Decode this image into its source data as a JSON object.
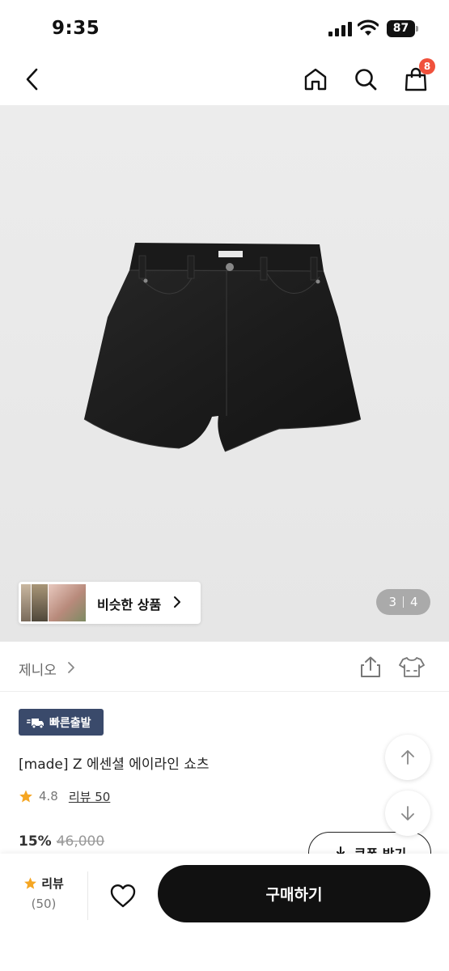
{
  "status_bar": {
    "time": "9:35",
    "battery": "87"
  },
  "header": {
    "cart_count": "8"
  },
  "gallery": {
    "similar_label": "비슷한 상품",
    "current_page": "3",
    "total_pages": "4"
  },
  "brand": {
    "name": "제니오"
  },
  "product": {
    "badge": "빠른출발",
    "title": "[made] Z 에센셜 에이라인 쇼츠",
    "rating": "4.8",
    "review_label": "리뷰 50",
    "discount": "15%",
    "original_price": "46,000",
    "coupon_label": "쿠폰 받기"
  },
  "bottom_bar": {
    "review_label": "리뷰",
    "review_count": "(50)",
    "buy_label": "구매하기"
  },
  "colors": {
    "accent": "#111111",
    "badge": "#3a4a6b",
    "cart_badge": "#f0513c",
    "star": "#f5a623"
  }
}
